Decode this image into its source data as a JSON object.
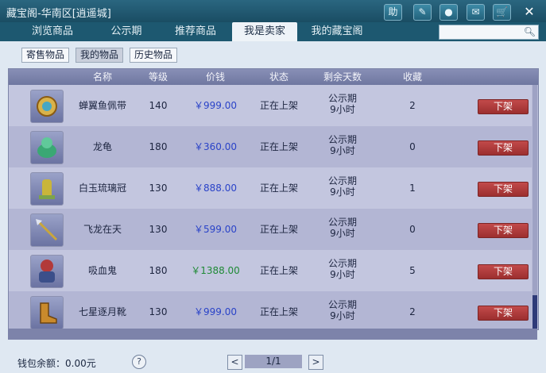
{
  "window": {
    "title": "藏宝阁-华南区[逍遥城]"
  },
  "titlebar_buttons": [
    {
      "label": "助",
      "icon": "help-icon"
    },
    {
      "label": "✎",
      "icon": "edit-icon"
    },
    {
      "label": "●",
      "icon": "record-icon"
    },
    {
      "label": "✉",
      "icon": "chat-icon"
    },
    {
      "label": "🛒",
      "icon": "cart-icon"
    },
    {
      "label": "✕",
      "icon": "close-icon"
    }
  ],
  "tabs": [
    {
      "label": "浏览商品"
    },
    {
      "label": "公示期"
    },
    {
      "label": "推荐商品"
    },
    {
      "label": "我是卖家"
    },
    {
      "label": "我的藏宝阁"
    }
  ],
  "active_tab": 3,
  "search": {
    "value": "",
    "placeholder": ""
  },
  "subtabs": [
    {
      "label": "寄售物品"
    },
    {
      "label": "我的物品"
    },
    {
      "label": "历史物品"
    }
  ],
  "active_subtab": 1,
  "table": {
    "headers": [
      "名称",
      "等级",
      "价钱",
      "状态",
      "剩余天数",
      "收藏"
    ],
    "rows": [
      {
        "name": "蝉翼鱼佩带",
        "level": "140",
        "price": "￥999.00",
        "price_color": "#2a43c8",
        "status": "正在上架",
        "remain1": "公示期",
        "remain2": "9小时",
        "fav": "2",
        "action": "下架",
        "icon": "jade-pendant-icon"
      },
      {
        "name": "龙龟",
        "level": "180",
        "price": "￥360.00",
        "price_color": "#2a43c8",
        "status": "正在上架",
        "remain1": "公示期",
        "remain2": "9小时",
        "fav": "0",
        "action": "下架",
        "icon": "dragon-turtle-icon"
      },
      {
        "name": "白玉琉璃冠",
        "level": "130",
        "price": "￥888.00",
        "price_color": "#2a43c8",
        "status": "正在上架",
        "remain1": "公示期",
        "remain2": "9小时",
        "fav": "1",
        "action": "下架",
        "icon": "crown-icon"
      },
      {
        "name": "飞龙在天",
        "level": "130",
        "price": "￥599.00",
        "price_color": "#2a43c8",
        "status": "正在上架",
        "remain1": "公示期",
        "remain2": "9小时",
        "fav": "0",
        "action": "下架",
        "icon": "spear-icon"
      },
      {
        "name": "吸血鬼",
        "level": "180",
        "price": "￥1388.00",
        "price_color": "#1f8a36",
        "status": "正在上架",
        "remain1": "公示期",
        "remain2": "9小时",
        "fav": "5",
        "action": "下架",
        "icon": "vampire-icon"
      },
      {
        "name": "七星逐月靴",
        "level": "130",
        "price": "￥999.00",
        "price_color": "#2a43c8",
        "status": "正在上架",
        "remain1": "公示期",
        "remain2": "9小时",
        "fav": "2",
        "action": "下架",
        "icon": "boots-icon"
      }
    ]
  },
  "footer": {
    "wallet": "钱包余额：0.00元",
    "help": "?",
    "prev": "<",
    "page": "1/1",
    "next": ">"
  }
}
